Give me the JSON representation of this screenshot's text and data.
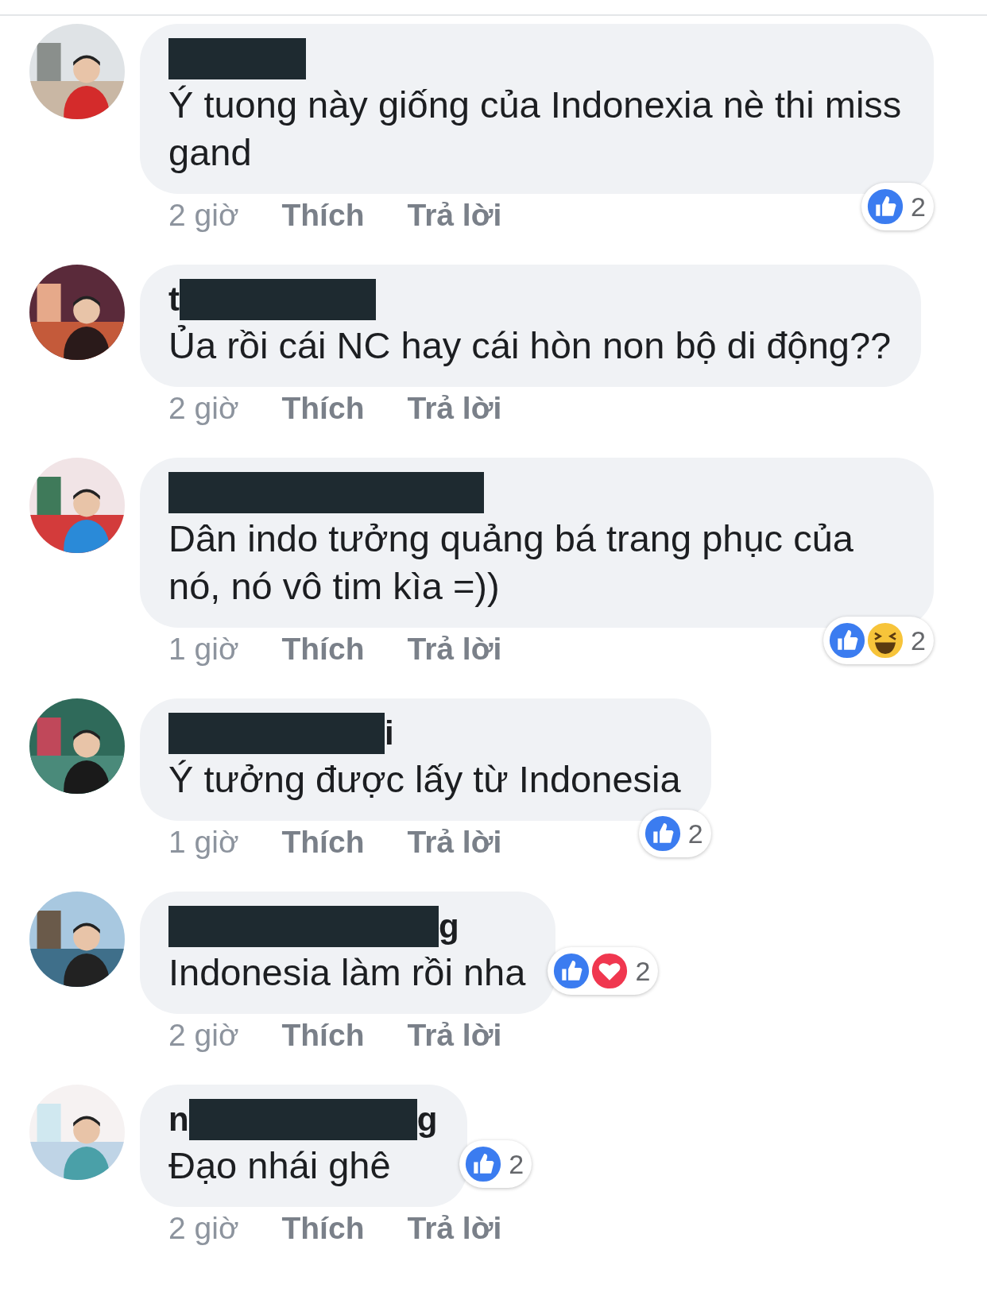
{
  "comments": [
    {
      "text": "Ý tuong này giống của Indonexia nè thi miss gand",
      "time": "2 giờ",
      "like": "Thích",
      "reply": "Trả lời",
      "reactions": {
        "icons": [
          {
            "kind": "like"
          }
        ],
        "count": "2"
      }
    },
    {
      "name": {
        "prefix": "t"
      },
      "text": "Ủa rồi cái NC hay cái hòn non bộ di động??",
      "time": "2 giờ",
      "like": "Thích",
      "reply": "Trả lời"
    },
    {
      "text": "Dân indo tưởng quảng bá trang phục của nó, nó vô tim kìa =))",
      "time": "1 giờ",
      "like": "Thích",
      "reply": "Trả lời",
      "reactions": {
        "icons": [
          {
            "kind": "like"
          },
          {
            "kind": "haha"
          }
        ],
        "count": "2"
      }
    },
    {
      "name": {
        "suffix": "i"
      },
      "text": "Ý tưởng được lấy từ Indonesia",
      "time": "1 giờ",
      "like": "Thích",
      "reply": "Trả lời",
      "reactions": {
        "icons": [
          {
            "kind": "like"
          }
        ],
        "count": "2"
      }
    },
    {
      "name": {
        "suffix": "g"
      },
      "text": "Indonesia làm rồi nha",
      "time": "2 giờ",
      "like": "Thích",
      "reply": "Trả lời",
      "reactions": {
        "icons": [
          {
            "kind": "like"
          },
          {
            "kind": "love"
          }
        ],
        "count": "2"
      }
    },
    {
      "name": {
        "prefix": "n",
        "suffix": "g"
      },
      "text": "Đạo nhái ghê",
      "time": "2 giờ",
      "like": "Thích",
      "reply": "Trả lời",
      "reactions": {
        "icons": [
          {
            "kind": "like"
          }
        ],
        "count": "2"
      }
    }
  ]
}
